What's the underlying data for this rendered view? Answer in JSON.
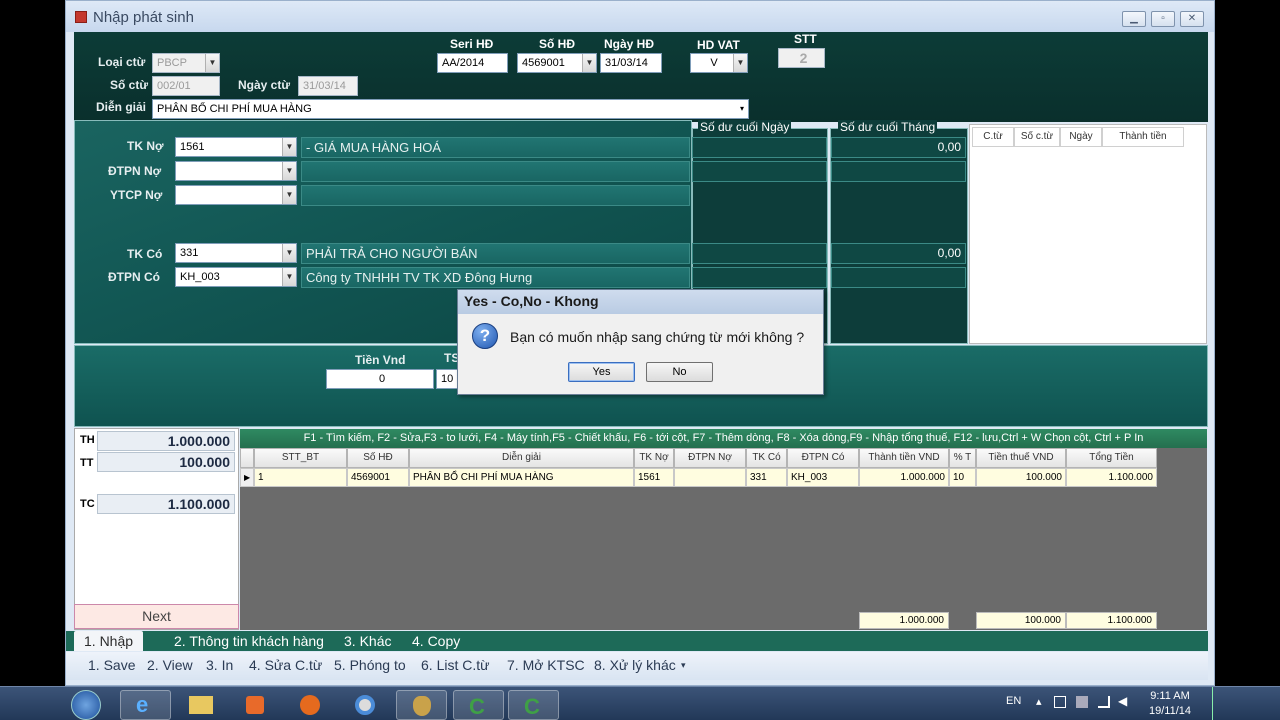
{
  "window": {
    "title": "Nhập phát sinh"
  },
  "header": {
    "loai_ctu_label": "Loại ctừ",
    "loai_ctu_value": "PBCP",
    "so_ctu_label": "Số ctừ",
    "so_ctu_value": "002/01",
    "ngay_ctu_label": "Ngày ctừ",
    "ngay_ctu_value": "31/03/14",
    "dien_giai_label": "Diễn giải",
    "dien_giai_value": "PHÂN BỔ CHI PHÍ MUA HÀNG",
    "seri_hd_label": "Seri HĐ",
    "seri_hd_value": "AA/2014",
    "so_hd_label": "Số HĐ",
    "so_hd_value": "4569001",
    "ngay_hd_label": "Ngày HĐ",
    "ngay_hd_value": "31/03/14",
    "hd_vat_label": "HD VAT",
    "hd_vat_value": "V",
    "stt_label": "STT",
    "stt_value": "2"
  },
  "accounts": {
    "tk_no_label": "TK Nợ",
    "tk_no_value": "1561",
    "tk_no_desc": "- GIÁ MUA HÀNG HOÁ",
    "dtpn_no_label": "ĐTPN Nợ",
    "dtpn_no_value": "",
    "dtpn_no_desc": "",
    "ytcp_no_label": "YTCP Nợ",
    "ytcp_no_value": "",
    "ytcp_no_desc": "",
    "tk_co_label": "TK Có",
    "tk_co_value": "331",
    "tk_co_desc": "PHẢI TRẢ CHO NGƯỜI BÁN",
    "dtpn_co_label": "ĐTPN Có",
    "dtpn_co_value": "KH_003",
    "dtpn_co_desc": "Công ty TNHHH TV TK  XD Đông Hưng"
  },
  "balances": {
    "ngay_title": "Số dư cuối Ngày",
    "thang_title": "Số dư cuối Tháng",
    "tk_no_thang": "0,00",
    "tk_co_thang": "0,00"
  },
  "right_grid": {
    "headers": [
      "C.từ",
      "Số c.từ",
      "Ngày",
      "Thành tiền"
    ]
  },
  "middle": {
    "tien_vnd_label": "Tiền Vnd",
    "tien_vnd_value": "0",
    "ts_label": "TS",
    "ts_value": "10"
  },
  "totals": {
    "th_label": "TH",
    "th_value": "1.000.000",
    "tt_label": "TT",
    "tt_value": "100.000",
    "tc_label": "TC",
    "tc_value": "1.100.000"
  },
  "next_label": "Next",
  "fkeys": "F1 - Tìm kiếm, F2 - Sửa,F3 - to lưới, F4 - Máy tính,F5 - Chiết khấu, F6 - tới cột, F7 - Thêm dòng, F8 - Xóa dòng,F9 - Nhập tổng thuế, F12 - lưu,Ctrl + W Chọn cột, Ctrl + P In",
  "grid": {
    "headers": [
      "STT_BT",
      "Số HĐ",
      "Diễn giải",
      "TK Nợ",
      "ĐTPN Nợ",
      "TK Có",
      "ĐTPN Có",
      "Thành tiền VND",
      "% T",
      "Tiền thuế VND",
      "Tổng Tiền"
    ],
    "row": [
      "1",
      "4569001",
      "PHÂN BỔ CHI PHÍ MUA HÀNG",
      "1561",
      "",
      "331",
      "KH_003",
      "1.000.000",
      "10",
      "100.000",
      "1.100.000"
    ],
    "footer": {
      "thanh_tien": "1.000.000",
      "tien_thue": "100.000",
      "tong_tien": "1.100.000"
    }
  },
  "tabs": [
    "1. Nhập",
    "2. Thông tin khách hàng",
    "3. Khác",
    "4. Copy"
  ],
  "menu": [
    "1. Save",
    "2. View",
    "3. In",
    "4. Sửa C.từ",
    "5. Phóng to",
    "6. List C.từ",
    "7. Mở KTSC",
    "8. Xử lý khác"
  ],
  "dialog": {
    "title": "Yes - Co,No - Khong",
    "message": "Bạn có muốn nhập sang chứng từ mới không ?",
    "yes": "Yes",
    "no": "No"
  },
  "taskbar": {
    "lang": "EN",
    "time": "9:11 AM",
    "date": "19/11/14"
  }
}
